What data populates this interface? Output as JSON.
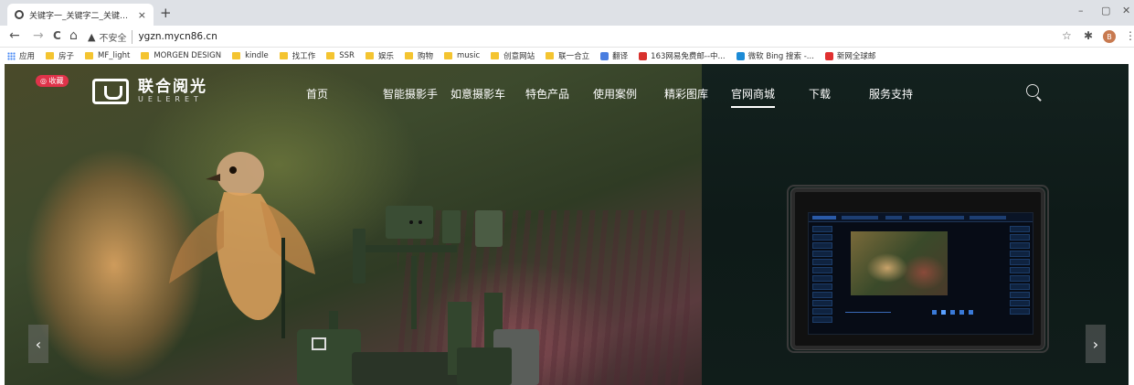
{
  "browser": {
    "tab_title": "关键字一_关键字二_关键字三-中",
    "tab_close": "×",
    "new_tab": "+",
    "nav": {
      "back": "←",
      "forward": "→",
      "reload": "C",
      "home": "⌂"
    },
    "security_icon": "▲",
    "security_label": "不安全",
    "url": "ygzn.mycn86.cn",
    "profile_initial": "B",
    "window_controls": {
      "minimize": "–",
      "restore": "▢",
      "close": "✕"
    },
    "toolbar_icons": {
      "star": "☆",
      "extensions": "✱",
      "menu": "⋮"
    }
  },
  "bookmarks": [
    {
      "label": "应用",
      "icon": "apps-icon"
    },
    {
      "label": "房子",
      "icon": "folder-icon"
    },
    {
      "label": "MF_light",
      "icon": "folder-icon"
    },
    {
      "label": "MORGEN DESIGN",
      "icon": "folder-icon"
    },
    {
      "label": "kindle",
      "icon": "folder-icon"
    },
    {
      "label": "找工作",
      "icon": "folder-icon"
    },
    {
      "label": "SSR",
      "icon": "folder-icon"
    },
    {
      "label": "娱乐",
      "icon": "folder-icon"
    },
    {
      "label": "购物",
      "icon": "folder-icon"
    },
    {
      "label": "music",
      "icon": "folder-icon"
    },
    {
      "label": "创意网站",
      "icon": "folder-icon"
    },
    {
      "label": "联一合立",
      "icon": "folder-icon"
    },
    {
      "label": "翻译",
      "icon": "translate-icon"
    },
    {
      "label": "163网易免费邮--中...",
      "icon": "mail-icon"
    },
    {
      "label": "微软 Bing 搜索 -...",
      "icon": "bing-icon"
    },
    {
      "label": "新网全球邮",
      "icon": "bird-icon"
    }
  ],
  "site": {
    "live_badge": "◎ 收藏",
    "logo_cn": "联合阅光",
    "logo_en": "UELERET",
    "nav": [
      "首页",
      "智能摄影手",
      "如意摄影车",
      "特色产品",
      "使用案例",
      "精彩图库",
      "官网商城",
      "下载",
      "服务支持"
    ],
    "active_nav": "官网商城",
    "prev_arrow": "‹",
    "next_arrow": "›"
  },
  "colors": {
    "badge": "#e0334a",
    "screen_accent": "#2a5aa8"
  }
}
